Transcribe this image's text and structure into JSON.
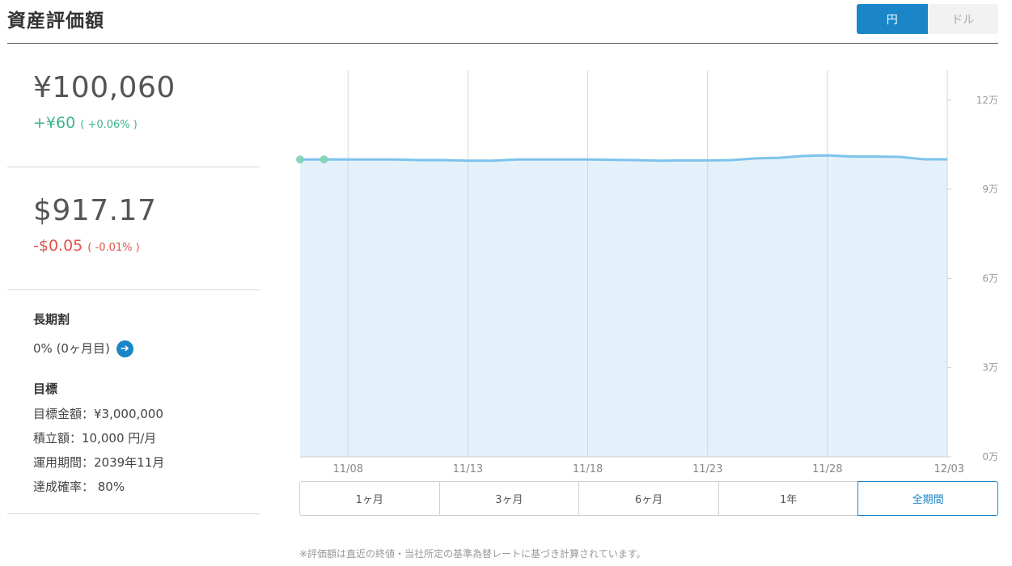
{
  "header": {
    "title": "資産評価額",
    "currency_toggle": [
      {
        "label": "円",
        "active": true
      },
      {
        "label": "ドル",
        "active": false
      }
    ]
  },
  "yen": {
    "amount": "¥100,060",
    "change": "+¥60",
    "change_pct": "( +0.06% )"
  },
  "usd": {
    "amount": "$917.17",
    "change": "-$0.05",
    "change_pct": "( -0.01% )"
  },
  "long_term": {
    "label": "長期割",
    "value": "0% (0ヶ月目)"
  },
  "goal": {
    "label": "目標",
    "items": [
      "目標金額：¥3,000,000",
      "積立額：10,000 円/月",
      "運用期間：2039年11月",
      "達成確率： 80%"
    ]
  },
  "periods": [
    {
      "label": "1ヶ月",
      "selected": false
    },
    {
      "label": "3ヶ月",
      "selected": false
    },
    {
      "label": "6ヶ月",
      "selected": false
    },
    {
      "label": "1年",
      "selected": false
    },
    {
      "label": "全期間",
      "selected": true
    }
  ],
  "footnote": "※評価額は直近の終値・当社所定の基準為替レートに基づき計算されています。",
  "colors": {
    "accent": "#1a86c8",
    "positive": "#3fb489",
    "negative": "#e0524a",
    "line": "#7dc3ec",
    "fill": "#e4f1fa"
  },
  "chart_data": {
    "type": "area",
    "x_ticks": [
      "11/08",
      "11/13",
      "11/18",
      "11/23",
      "11/28",
      "12/03"
    ],
    "y_ticks": [
      "0万",
      "3万",
      "6万",
      "9万",
      "12万"
    ],
    "ylim": [
      0,
      130000
    ],
    "y_tick_values": [
      0,
      30000,
      60000,
      90000,
      120000
    ],
    "x": [
      "11/06",
      "11/07",
      "11/08",
      "11/09",
      "11/10",
      "11/11",
      "11/12",
      "11/13",
      "11/14",
      "11/15",
      "11/16",
      "11/17",
      "11/18",
      "11/19",
      "11/20",
      "11/21",
      "11/22",
      "11/23",
      "11/24",
      "11/25",
      "11/26",
      "11/27",
      "11/28",
      "11/29",
      "11/30",
      "12/01",
      "12/02",
      "12/03"
    ],
    "values": [
      100000,
      100060,
      100020,
      100000,
      100000,
      99800,
      99800,
      99600,
      99600,
      100000,
      100000,
      100000,
      100000,
      99900,
      99800,
      99600,
      99700,
      99700,
      99800,
      100400,
      100600,
      101200,
      101400,
      101000,
      101000,
      100900,
      100100,
      100060
    ],
    "markers": [
      "11/06",
      "11/07"
    ],
    "grid": true,
    "y_axis_position": "right"
  }
}
